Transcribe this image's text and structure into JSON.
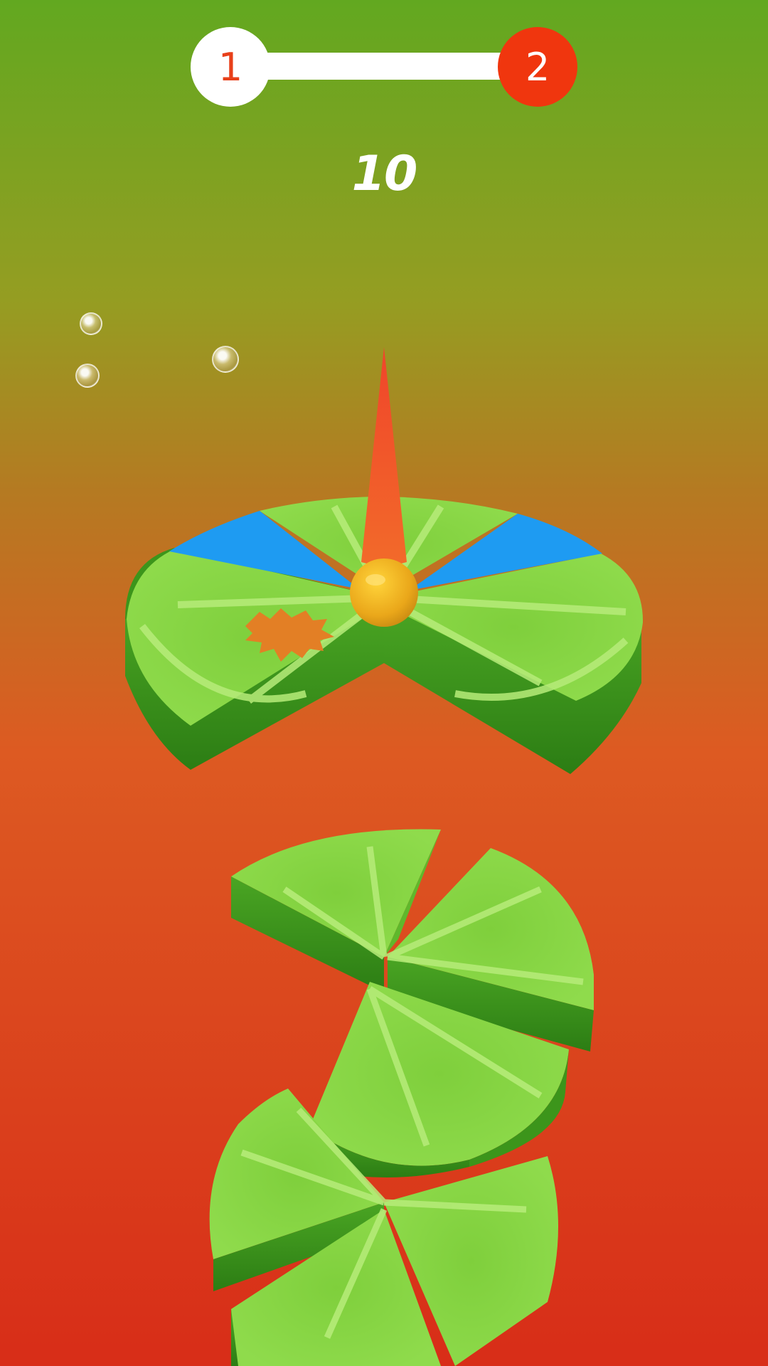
{
  "game": {
    "progress": {
      "current_level": "1",
      "next_level": "2",
      "fraction": 0.035
    },
    "score": "10"
  },
  "colors": {
    "background_top": "#62a820",
    "background_mid": "#b57a22",
    "background_bottom": "#db2f1a",
    "lime_light": "#8ed64a",
    "lime_mid": "#6cc232",
    "lime_dark": "#2f8417",
    "danger_blue": "#1e9bf2",
    "ball": "#f2b21e",
    "trail": "#f1572b",
    "splat": "#e37f25"
  },
  "icons": {
    "ball": "ball-icon",
    "bubble": "bubble-icon"
  }
}
